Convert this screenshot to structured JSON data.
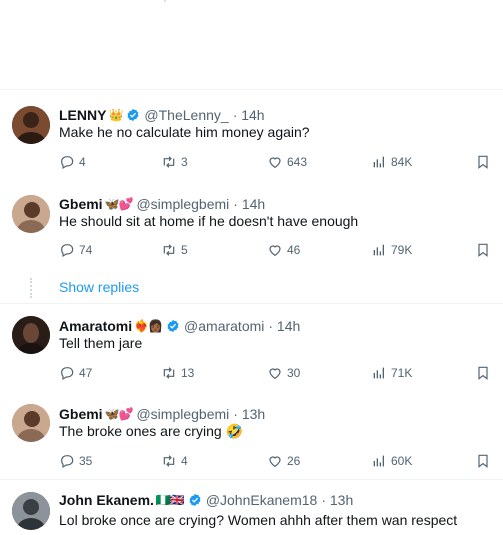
{
  "tweets": [
    {
      "name": "LENNY",
      "emoji": "👑",
      "handle": "@TheLenny_",
      "time": "· 14h",
      "text": "Make he no calculate him money again?",
      "replies": "4",
      "retweets": "3",
      "likes": "643",
      "views": "84K",
      "avatar_color": "#6b3f2a"
    },
    {
      "name": "Gbemi",
      "emoji": "🦋💕",
      "handle": "@simplegbemi",
      "time": "· 14h",
      "text": "He should sit at home if he doesn't have enough",
      "replies": "74",
      "retweets": "5",
      "likes": "46",
      "views": "79K",
      "avatar_color": "#b08a6e"
    },
    {
      "name": "Amaratomi",
      "emoji": "❤️‍🔥👩🏾",
      "handle": "@amaratomi",
      "time": "· 14h",
      "text": "Tell them jare",
      "replies": "47",
      "retweets": "13",
      "likes": "30",
      "views": "71K",
      "avatar_color": "#2a1d18"
    },
    {
      "name": "Gbemi",
      "emoji": "🦋💕",
      "handle": "@simplegbemi",
      "time": "· 13h",
      "text": "The broke ones are crying 🤣",
      "replies": "35",
      "retweets": "4",
      "likes": "26",
      "views": "60K",
      "avatar_color": "#b08a6e"
    },
    {
      "name": "John Ekanem.",
      "emoji": "🇳🇬🇬🇧",
      "handle": "@JohnEkanem18",
      "time": "· 13h",
      "text": "Lol broke once are crying? Women ahhh after them wan respect",
      "avatar_color": "#4a4f55"
    }
  ],
  "show_replies": "Show replies",
  "colors": {
    "accent": "#1d9bf0",
    "muted": "#536471",
    "text": "#0f1419"
  }
}
